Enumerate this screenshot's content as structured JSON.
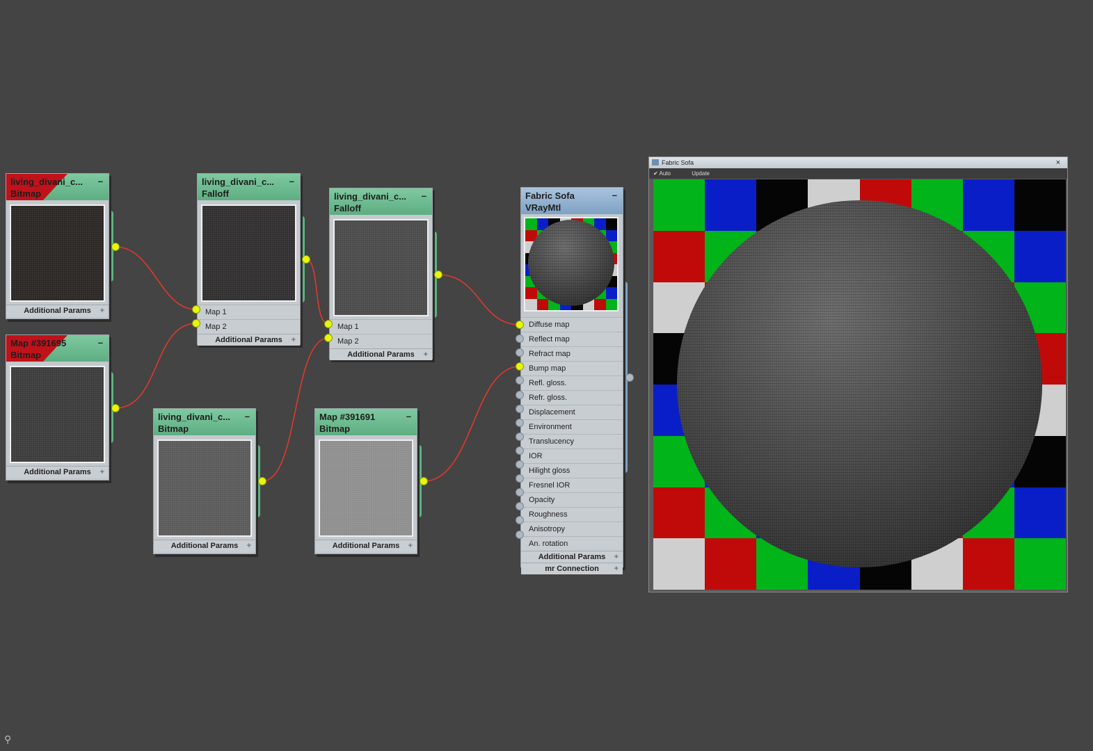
{
  "nodes": {
    "bitmap_a": {
      "title": "living_divani_c...",
      "type": "Bitmap",
      "footer": "Additional Params"
    },
    "bitmap_b": {
      "title": "Map #391695",
      "type": "Bitmap",
      "footer": "Additional Params"
    },
    "falloff_1": {
      "title": "living_divani_c...",
      "type": "Falloff",
      "slots": [
        "Map 1",
        "Map 2"
      ],
      "footer": "Additional Params"
    },
    "falloff_2": {
      "title": "living_divani_c...",
      "type": "Falloff",
      "slots": [
        "Map 1",
        "Map 2"
      ],
      "footer": "Additional Params"
    },
    "bitmap_c": {
      "title": "living_divani_c...",
      "type": "Bitmap",
      "footer": "Additional Params"
    },
    "bitmap_d": {
      "title": "Map #391691",
      "type": "Bitmap",
      "footer": "Additional Params"
    },
    "material": {
      "title": "Fabric Sofa",
      "type": "VRayMtl",
      "slots": [
        "Diffuse map",
        "Reflect map",
        "Refract map",
        "Bump map",
        "Refl. gloss.",
        "Refr. gloss.",
        "Displacement",
        "Environment",
        "Translucency",
        "IOR",
        "Hilight gloss",
        "Fresnel IOR",
        "Opacity",
        "Roughness",
        "Anisotropy",
        "An. rotation"
      ],
      "connected_slots": [
        "Diffuse map",
        "Bump map"
      ],
      "footers": [
        "Additional Params",
        "mr Connection"
      ]
    }
  },
  "viewer": {
    "title": "Fabric Sofa",
    "toolbar": [
      "Auto",
      "Update"
    ],
    "checker_colors": {
      "green": "#00b419",
      "blue": "#0a1ec8",
      "black": "#050505",
      "gray": "#cfcfcf",
      "red": "#c00a0a"
    }
  },
  "icons": {
    "minimize": "minimize-icon",
    "plus": "plus-icon",
    "close": "close-icon",
    "corner": "binoculars-icon"
  },
  "colors": {
    "wire": "#e0382e",
    "port_active": "#e6f70c",
    "port_idle": "#aeb8c2",
    "node_header": "#6cbb8f",
    "material_header": "#94b3d0",
    "error_header": "#c0121a"
  }
}
